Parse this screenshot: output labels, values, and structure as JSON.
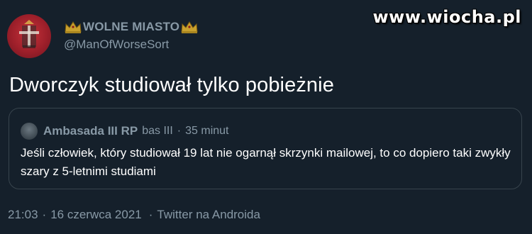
{
  "author": {
    "display_name": "WOLNE MIASTO",
    "handle": "@ManOfWorseSort",
    "avatar_icon": "city-coat-of-arms-icon",
    "name_badge_icon": "crown-icon"
  },
  "watermark": "www.wiocha.pl",
  "tweet": {
    "text": "Dworczyk studiował tylko pobieżnie"
  },
  "quoted_tweet": {
    "display_name": "Ambasada III RP",
    "handle": "bas III",
    "separator": "·",
    "time_ago": "35 minut",
    "text": "Jeśli człowiek, który studiował 19 lat nie ogarnął skrzynki mailowej, to co dopiero taki zwykły szary z 5-letnimi studiami"
  },
  "meta": {
    "time": "21:03",
    "date": "16 czerwca 2021",
    "source": "Twitter na Androida",
    "separator": "·"
  },
  "colors": {
    "background": "#15202b",
    "secondary_text": "#8899a6",
    "border": "#38444d",
    "avatar_red": "#9d1f2a"
  }
}
